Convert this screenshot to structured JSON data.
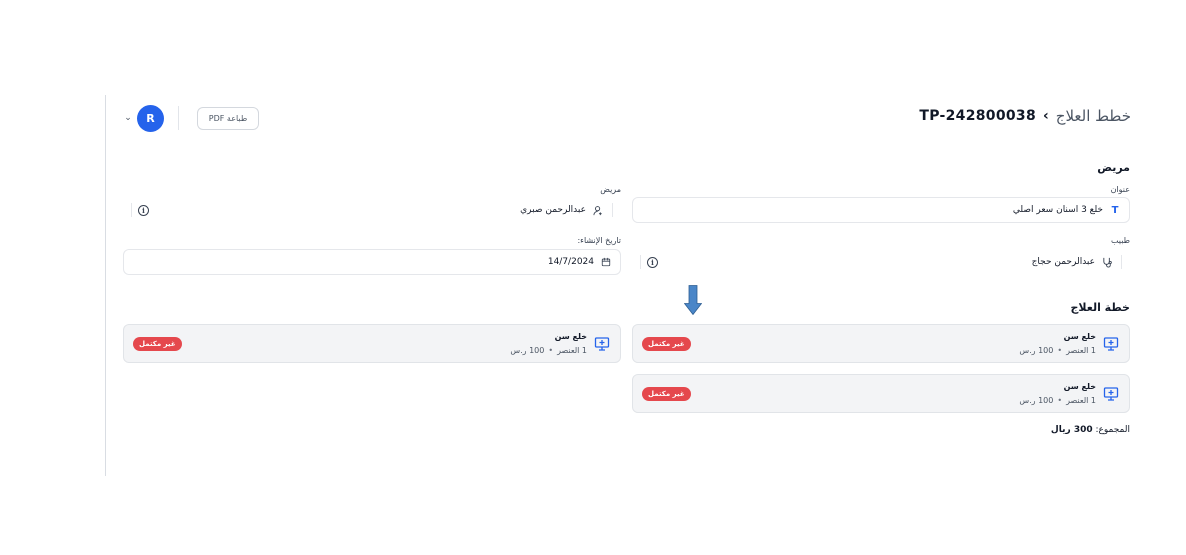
{
  "header": {
    "breadcrumb_parent": "خطط العلاج",
    "plan_code": "TP-242800038",
    "print_label": "طباعة PDF",
    "avatar_initial": "R"
  },
  "patient_section": {
    "title": "مريض",
    "title_label": "عنوان",
    "title_value": "خلع 3 اسنان سعر اصلي",
    "patient_label": "مريض",
    "patient_value": "عبدالرحمن صبري",
    "doctor_label": "طبيب",
    "doctor_value": "عبدالرحمن حجاج",
    "created_label": "تاريخ الإنشاء:",
    "created_value": "14/7/2024"
  },
  "plan_section": {
    "title": "خطة العلاج",
    "items": [
      {
        "name": "خلع سن",
        "count": "1 العنصر",
        "price": "100 ر.س",
        "status": "غير مكتمل"
      },
      {
        "name": "خلع سن",
        "count": "1 العنصر",
        "price": "100 ر.س",
        "status": "غير مكتمل"
      },
      {
        "name": "خلع سن",
        "count": "1 العنصر",
        "price": "100 ر.س",
        "status": "غير مكتمل"
      }
    ],
    "total_label": "المجموع:",
    "total_value": "300 ريال"
  },
  "colors": {
    "accent": "#2563eb",
    "status_incomplete": "#e5484d",
    "arrow": "#4a86c8"
  }
}
